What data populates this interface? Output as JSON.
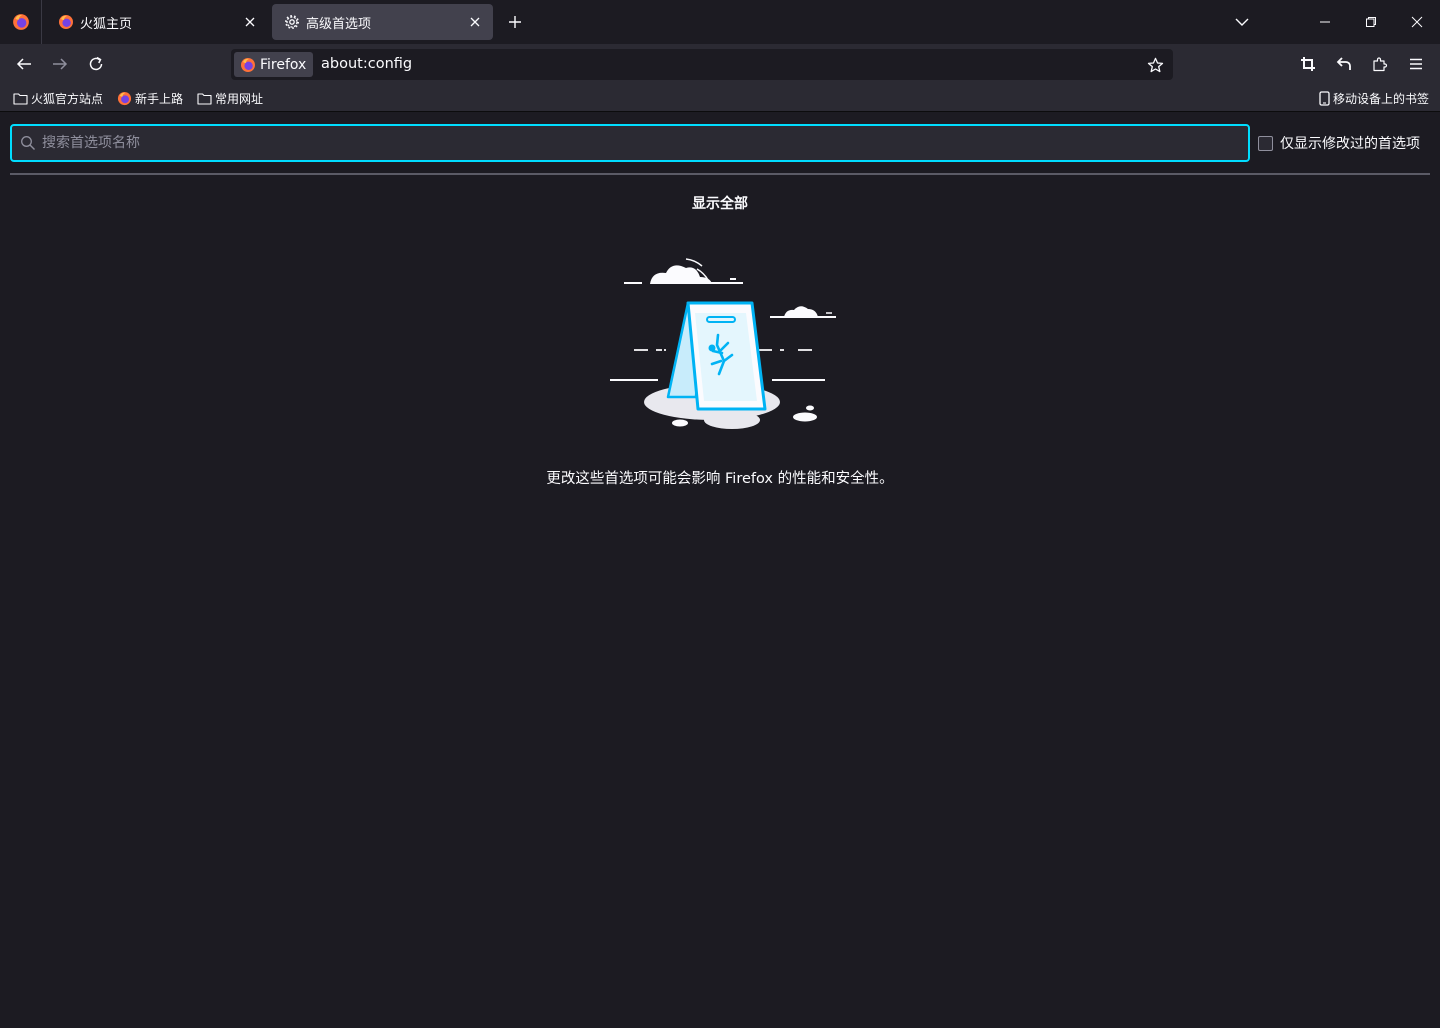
{
  "tabs": [
    {
      "title": "火狐主页",
      "icon": "firefox-icon",
      "active": false
    },
    {
      "title": "高级首选项",
      "icon": "gear-icon",
      "active": true
    }
  ],
  "navbar": {
    "identity_label": "Firefox",
    "url": "about:config"
  },
  "bookmarks": {
    "items": [
      {
        "label": "火狐官方站点",
        "icon": "folder-icon"
      },
      {
        "label": "新手上路",
        "icon": "firefox-icon"
      },
      {
        "label": "常用网址",
        "icon": "folder-icon"
      }
    ],
    "mobile": {
      "label": "移动设备上的书签",
      "icon": "mobile-icon"
    }
  },
  "config": {
    "search_placeholder": "搜索首选项名称",
    "modified_only_label": "仅显示修改过的首选项",
    "show_all": "显示全部",
    "warning": "更改这些首选项可能会影响 Firefox 的性能和安全性。"
  },
  "colors": {
    "accent": "#00ddff",
    "background": "#1c1b22",
    "toolbar": "#2b2a33",
    "active_tab": "#42414d",
    "illustration_blue": "#00b3f4"
  }
}
